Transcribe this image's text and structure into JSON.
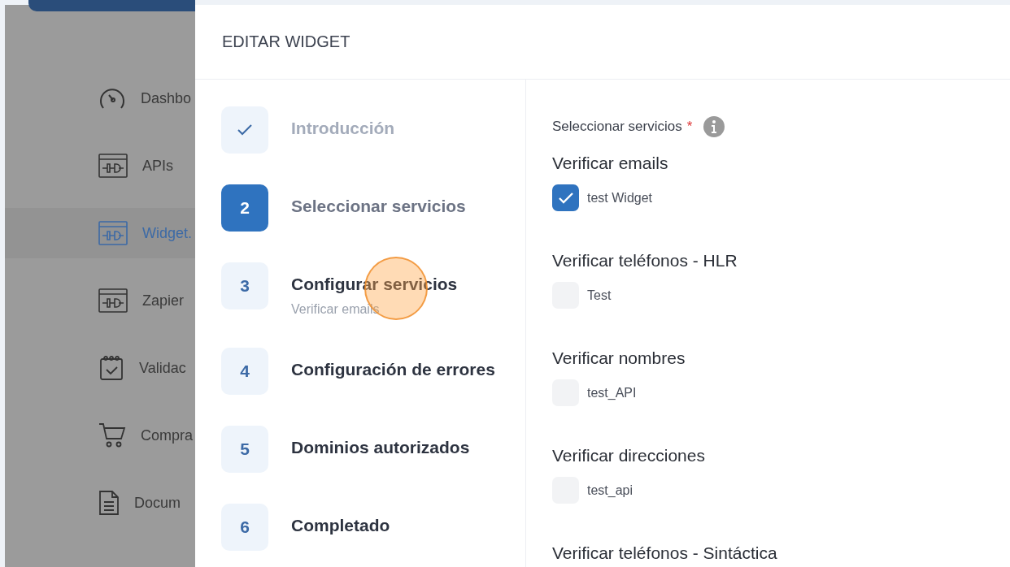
{
  "sidebar": {
    "items": [
      {
        "label": "Dashbo",
        "selected": false
      },
      {
        "label": "APIs",
        "selected": false
      },
      {
        "label": "Widget.",
        "selected": true
      },
      {
        "label": "Zapier",
        "selected": false
      },
      {
        "label": "Validac",
        "selected": false
      },
      {
        "label": "Compra",
        "selected": false
      },
      {
        "label": "Docum",
        "selected": false
      }
    ]
  },
  "drawer": {
    "title": "EDITAR WIDGET",
    "steps": [
      {
        "kind": "done",
        "title": "Introducción"
      },
      {
        "kind": "active",
        "number": "2",
        "title": "Seleccionar servicios"
      },
      {
        "kind": "pending",
        "number": "3",
        "title": "Configurar servicios",
        "subtitle": "Verificar emails"
      },
      {
        "kind": "pending",
        "number": "4",
        "title": "Configuración de errores"
      },
      {
        "kind": "pending",
        "number": "5",
        "title": "Dominios autorizados"
      },
      {
        "kind": "pending",
        "number": "6",
        "title": "Completado"
      }
    ],
    "services": {
      "label": "Seleccionar servicios",
      "required_mark": "*",
      "groups": [
        {
          "title": "Verificar emails",
          "options": [
            {
              "label": "test Widget",
              "checked": true
            }
          ]
        },
        {
          "title": "Verificar teléfonos - HLR",
          "options": [
            {
              "label": "Test",
              "checked": false
            }
          ]
        },
        {
          "title": "Verificar nombres",
          "options": [
            {
              "label": "test_API",
              "checked": false
            }
          ]
        },
        {
          "title": "Verificar direcciones",
          "options": [
            {
              "label": "test_api",
              "checked": false
            }
          ]
        },
        {
          "title": "Verificar teléfonos - Sintáctica"
        }
      ]
    }
  }
}
